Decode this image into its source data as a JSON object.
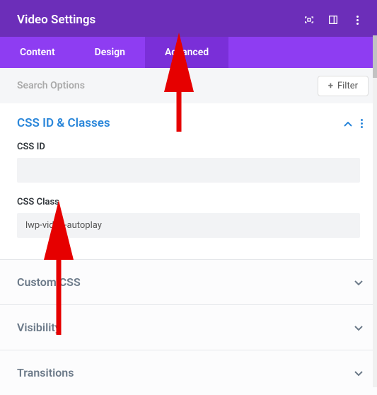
{
  "header": {
    "title": "Video Settings",
    "icons": [
      "expand-icon",
      "panel-icon",
      "more-icon"
    ]
  },
  "tabs": {
    "items": [
      {
        "label": "Content",
        "active": false
      },
      {
        "label": "Design",
        "active": false
      },
      {
        "label": "Advanced",
        "active": true
      }
    ]
  },
  "search": {
    "placeholder": "Search Options",
    "filter_label": "Filter"
  },
  "sections": {
    "css_id_classes": {
      "title": "CSS ID & Classes",
      "expanded": true,
      "fields": {
        "css_id": {
          "label": "CSS ID",
          "value": ""
        },
        "css_class": {
          "label": "CSS Class",
          "value": "lwp-video-autoplay"
        }
      }
    },
    "custom_css": {
      "title": "Custom CSS",
      "expanded": false
    },
    "visibility": {
      "title": "Visibility",
      "expanded": false
    },
    "transitions": {
      "title": "Transitions",
      "expanded": false
    }
  }
}
